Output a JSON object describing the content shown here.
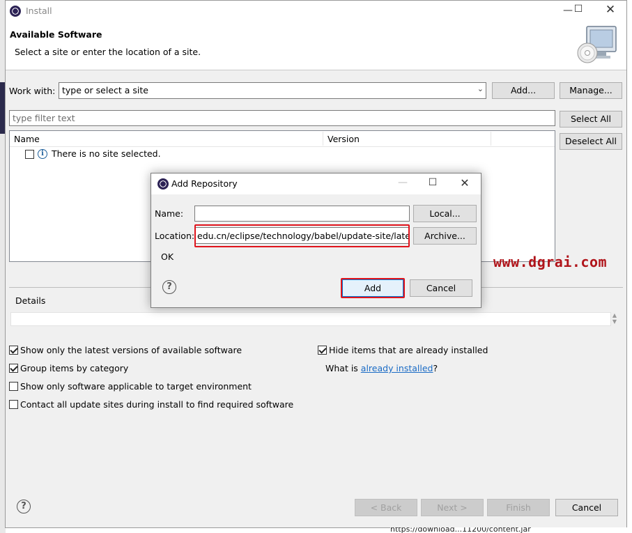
{
  "window": {
    "title": "Install",
    "header_title": "Available Software",
    "header_desc": "Select a site or enter the location of a site."
  },
  "work_with": {
    "label": "Work with:",
    "placeholder": "type or select a site",
    "add_label": "Add...",
    "manage_label": "Manage..."
  },
  "filter": {
    "placeholder": "type filter text",
    "select_all_label": "Select All",
    "deselect_all_label": "Deselect All"
  },
  "tree": {
    "columns": [
      "Name",
      "Version"
    ],
    "rows": [
      {
        "label": "There is no site selected.",
        "checked": false
      }
    ]
  },
  "details": {
    "label": "Details"
  },
  "options": {
    "show_latest": {
      "label": "Show only the latest versions of available software",
      "checked": true
    },
    "group_by_category": {
      "label": "Group items by category",
      "checked": true
    },
    "show_applicable": {
      "label": "Show only software applicable to target environment",
      "checked": false
    },
    "contact_sites": {
      "label": "Contact all update sites during install to find required software",
      "checked": false
    },
    "hide_installed": {
      "label": "Hide items that are already installed",
      "checked": true
    },
    "what_is_prefix": "What is ",
    "already_installed_link": "already installed",
    "what_is_suffix": "?"
  },
  "footer": {
    "back_label": "< Back",
    "next_label": "Next >",
    "finish_label": "Finish",
    "cancel_label": "Cancel",
    "status_text": "https://download...11200/content.jar"
  },
  "dialog": {
    "title": "Add Repository",
    "name_label": "Name:",
    "name_value": "",
    "local_label": "Local...",
    "location_label": "Location:",
    "location_value": "edu.cn/eclipse/technology/babel/update-site/latest/",
    "archive_label": "Archive...",
    "status_text": "OK",
    "add_label": "Add",
    "cancel_label": "Cancel"
  },
  "watermark": "www.dgrai.com",
  "colors": {
    "highlight_red": "#e0141c",
    "watermark_red": "#b0141a",
    "link_blue": "#1a6bc5",
    "eclipse_purple": "#2c2255"
  },
  "icons": [
    "eclipse-icon",
    "minimize-icon",
    "maximize-icon",
    "close-icon",
    "info-icon",
    "help-icon",
    "cd-monitor-icon",
    "dropdown-arrow-icon"
  ]
}
